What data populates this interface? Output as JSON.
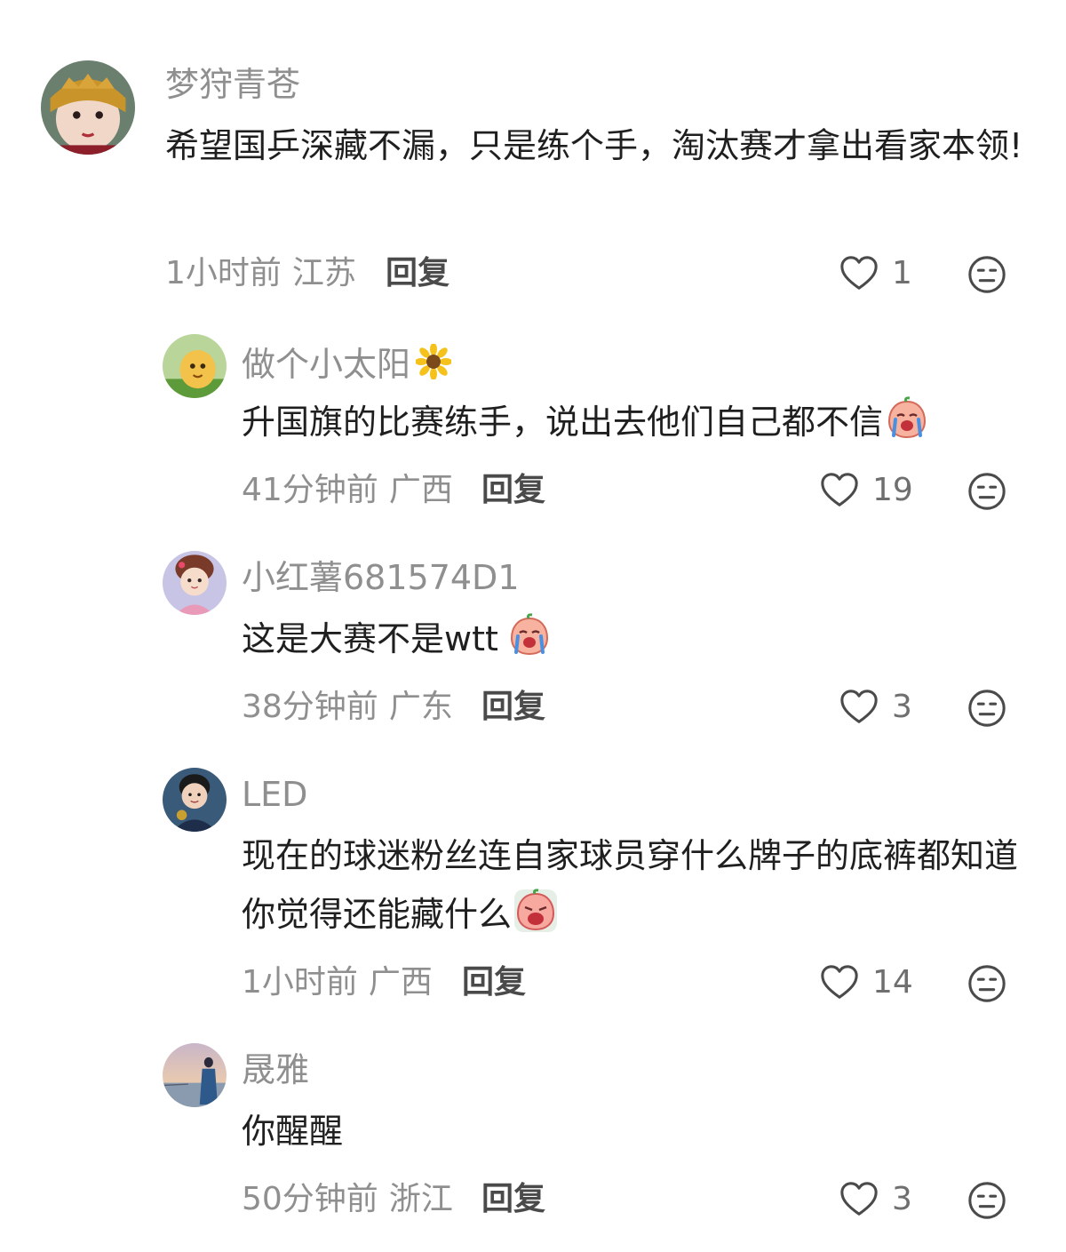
{
  "comments": [
    {
      "username": "梦狩青苍",
      "text": "希望国乒深藏不漏，只是练个手，淘汰赛才拿出看家本领!",
      "time": "1小时前",
      "location": "江苏",
      "reply_label": "回复",
      "likes": "1"
    },
    {
      "username": "做个小太阳",
      "text": "升国旗的比赛练手，说出去他们自己都不信",
      "time": "41分钟前",
      "location": "广西",
      "reply_label": "回复",
      "likes": "19"
    },
    {
      "username": "小红薯681574D1",
      "text": "这是大赛不是wtt",
      "time": "38分钟前",
      "location": "广东",
      "reply_label": "回复",
      "likes": "3"
    },
    {
      "username": "LED",
      "text": "现在的球迷粉丝连自家球员穿什么牌子的底裤都知道你觉得还能藏什么",
      "time": "1小时前",
      "location": "广西",
      "reply_label": "回复",
      "likes": "14"
    },
    {
      "username": "晟雅",
      "text": "你醒醒",
      "time": "50分钟前",
      "location": "浙江",
      "reply_label": "回复",
      "likes": "3"
    }
  ],
  "icons": {
    "like": "heart-outline-icon",
    "dislike": "neutral-face-icon",
    "sunflower": "sunflower-emoji",
    "crying": "crying-emoji"
  },
  "colors": {
    "username": "#8f8f8f",
    "text": "#1f1f1f",
    "reply": "#4a4a4a",
    "background": "#ffffff"
  }
}
